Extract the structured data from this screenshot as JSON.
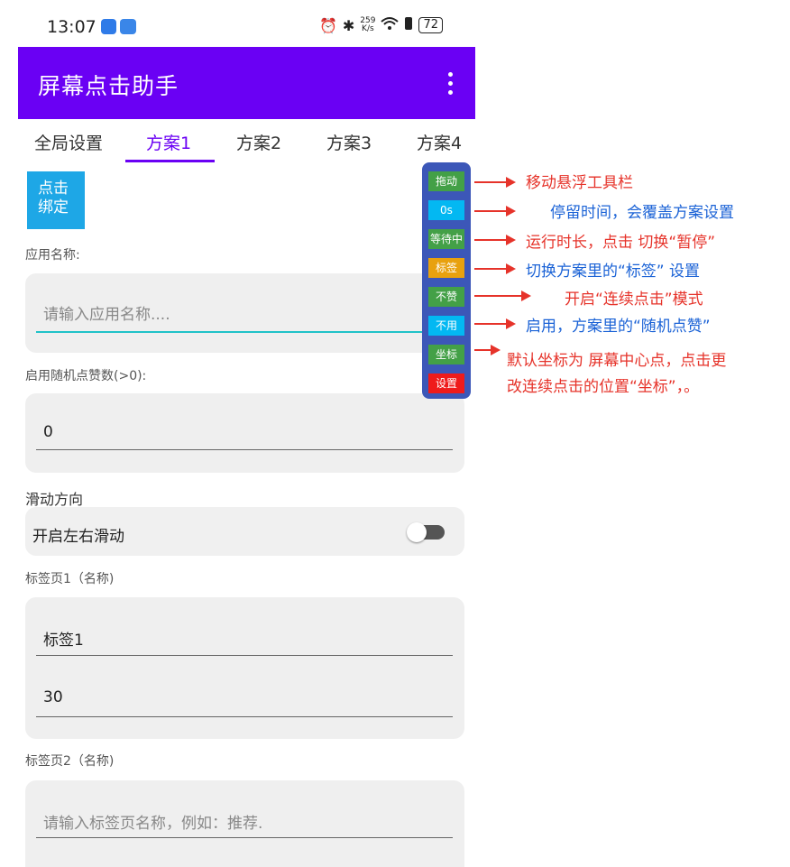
{
  "status_bar": {
    "time": "13:07",
    "right_icons": [
      "alarm-icon",
      "bluetooth-icon",
      "wifi-icon",
      "battery-saver-icon"
    ],
    "net_speed_value": "259",
    "net_speed_unit": "K/s",
    "battery": "72"
  },
  "app_bar": {
    "title": "屏幕点击助手",
    "background": "#6a00f4",
    "menu_icon": "more-vert-icon"
  },
  "tabs": [
    {
      "label": "全局设置",
      "active": false
    },
    {
      "label": "方案1",
      "active": true
    },
    {
      "label": "方案2",
      "active": false
    },
    {
      "label": "方案3",
      "active": false
    },
    {
      "label": "方案4",
      "active": false
    }
  ],
  "bind_button": {
    "label": "点击绑定",
    "color": "#1ea7e6"
  },
  "app_name": {
    "label": "应用名称:",
    "placeholder": "请输入应用名称...."
  },
  "random_like": {
    "label": "启用随机点赞数(>0):",
    "value": "0"
  },
  "swipe": {
    "section_title": "滑动方向",
    "switch_label": "开启左右滑动",
    "enabled": false
  },
  "tab_page1": {
    "label": "标签页1（名称)",
    "name_value": "标签1",
    "number_value": "30"
  },
  "tab_page2": {
    "label": "标签页2（名称)",
    "placeholder": "请输入标签页名称，例如：推荐."
  },
  "floating_toolbar": {
    "background": "#3c57b8",
    "buttons": [
      {
        "label": "拖动",
        "color": "#43a047"
      },
      {
        "label": "0s",
        "color": "#03b8f2"
      },
      {
        "label": "等待中",
        "color": "#43a047"
      },
      {
        "label": "标签",
        "color": "#e8a10e"
      },
      {
        "label": "不赞",
        "color": "#43a047"
      },
      {
        "label": "不用",
        "color": "#03b8f2"
      },
      {
        "label": "坐标",
        "color": "#43a047"
      },
      {
        "label": "设置",
        "color": "#ef1b1b"
      }
    ]
  },
  "annotations": [
    {
      "text": "移动悬浮工具栏",
      "color": "red"
    },
    {
      "text": "停留时间，会覆盖方案设置",
      "color": "blue"
    },
    {
      "text": "运行时长，点击 切换“暂停”",
      "color": "red"
    },
    {
      "text": "切换方案里的“标签” 设置",
      "color": "blue"
    },
    {
      "text": "开启“连续点击”模式",
      "color": "red"
    },
    {
      "text": "启用，方案里的“随机点赞”",
      "color": "blue"
    },
    {
      "text": "默认坐标为 屏幕中心点，点击更",
      "color": "red"
    },
    {
      "text": "改连续点击的位置“坐标”，。",
      "color": "red"
    }
  ]
}
